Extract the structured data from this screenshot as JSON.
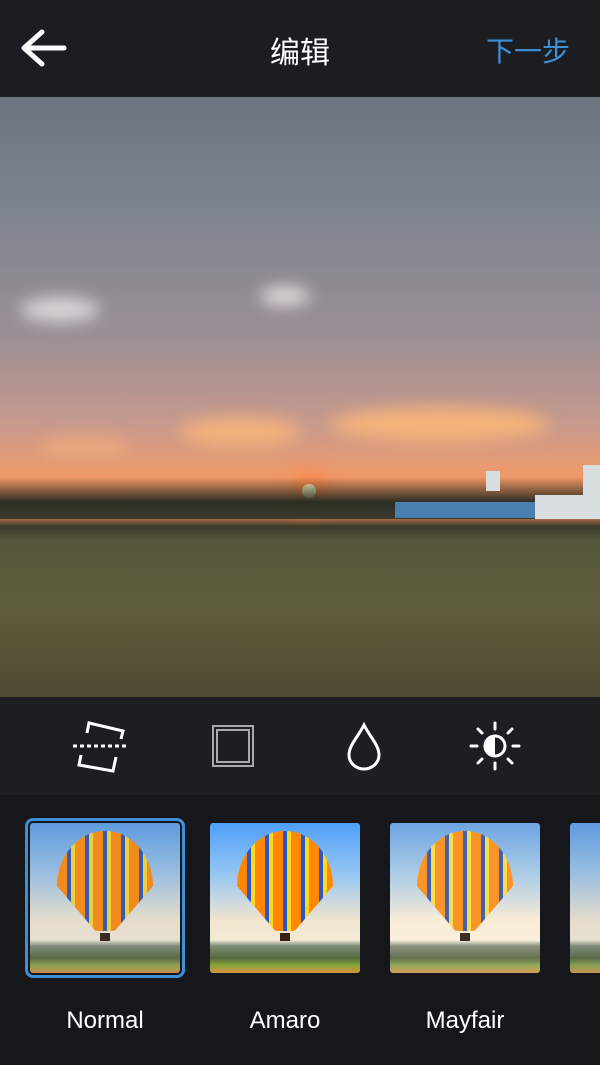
{
  "header": {
    "title": "编辑",
    "next_label": "下一步",
    "back_icon": "arrow-left-icon"
  },
  "colors": {
    "accent": "#3f8fd6",
    "header_bg": "#1b1d21",
    "toolbar_bg": "#1c1e22",
    "filter_bg": "#15171a"
  },
  "tools": [
    {
      "name": "straighten",
      "icon": "straighten-icon"
    },
    {
      "name": "frame",
      "icon": "frame-icon"
    },
    {
      "name": "tilt-shift",
      "icon": "drop-icon"
    },
    {
      "name": "lux",
      "icon": "brightness-icon"
    }
  ],
  "filters": [
    {
      "label": "Normal",
      "selected": true
    },
    {
      "label": "Amaro",
      "selected": false
    },
    {
      "label": "Mayfair",
      "selected": false
    }
  ]
}
